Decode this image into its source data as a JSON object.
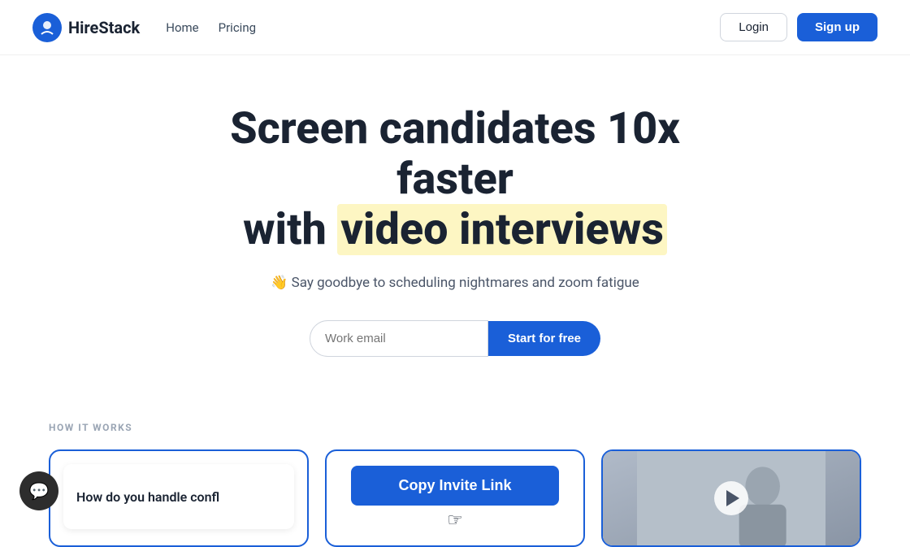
{
  "nav": {
    "logo_text": "HireStack",
    "links": [
      {
        "label": "Home",
        "id": "home"
      },
      {
        "label": "Pricing",
        "id": "pricing"
      }
    ],
    "login_label": "Login",
    "signup_label": "Sign up"
  },
  "hero": {
    "title_line1": "Screen candidates 10x faster",
    "title_line2_plain": "with ",
    "title_line2_highlight": "video interviews",
    "subtitle_emoji": "👋",
    "subtitle_text": " Say goodbye to scheduling nightmares and zoom fatigue",
    "email_placeholder": "Work email",
    "cta_label": "Start for free"
  },
  "how_it_works": {
    "section_label": "HOW IT WORKS",
    "card1": {
      "question": "How do you handle confl"
    },
    "card2": {
      "button_label": "Copy Invite Link",
      "cursor": "☞"
    },
    "card3": {
      "play_label": "▶"
    }
  },
  "chat": {
    "icon": "💬"
  }
}
